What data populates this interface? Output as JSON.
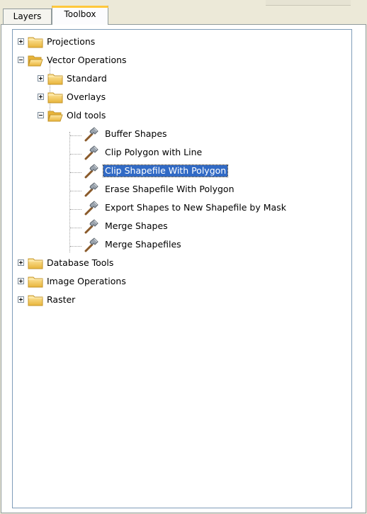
{
  "tabs": [
    {
      "label": "Layers",
      "active": false
    },
    {
      "label": "Toolbox",
      "active": true
    }
  ],
  "tree": {
    "projections": "Projections",
    "vector_operations": "Vector Operations",
    "standard": "Standard",
    "overlays": "Overlays",
    "old_tools": "Old tools",
    "tools": [
      "Buffer Shapes",
      "Clip Polygon with Line",
      "Clip Shapefile With Polygon",
      "Erase Shapefile With Polygon",
      "Export Shapes to New Shapefile by Mask",
      "Merge Shapes",
      "Merge Shapefiles"
    ],
    "selected_tool": "Clip Shapefile With Polygon",
    "database_tools": "Database Tools",
    "image_operations": "Image Operations",
    "raster": "Raster"
  },
  "colors": {
    "selection": "#316ac5",
    "folder": "#f3c64b",
    "tab_highlight": "#ffc83c"
  },
  "icons": {
    "collapsed": "plus-box-icon",
    "expanded": "minus-box-icon",
    "closed_folder": "folder-closed-icon",
    "open_folder": "folder-open-icon",
    "tool": "hammer-tool-icon"
  }
}
